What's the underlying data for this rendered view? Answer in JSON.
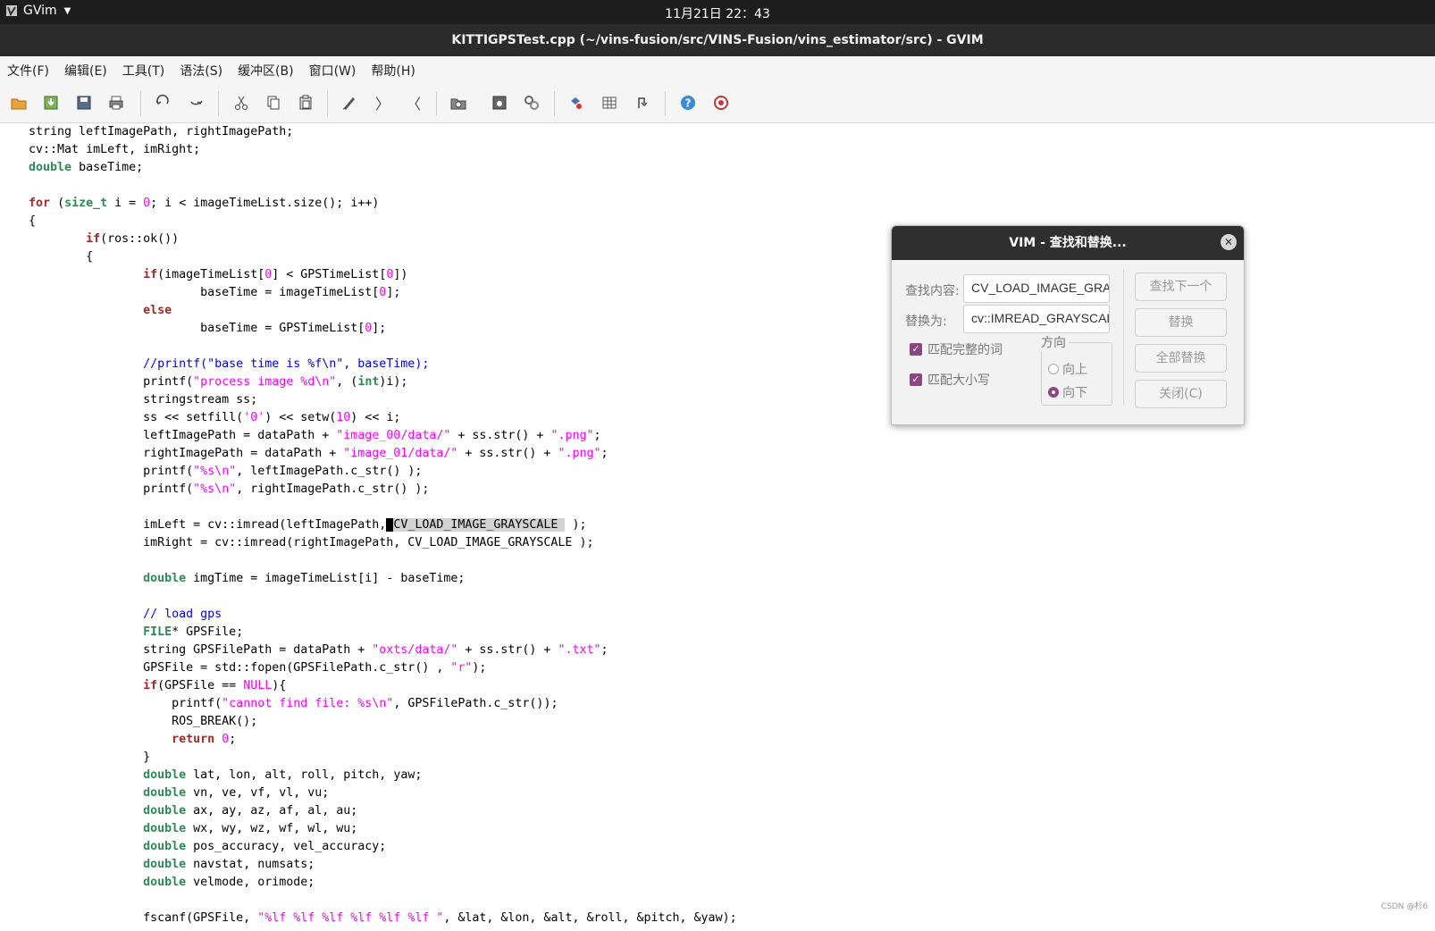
{
  "topbar": {
    "app_name": "GVim",
    "clock": "11月21日 22：43"
  },
  "window": {
    "title": "KITTIGPSTest.cpp (~/vins-fusion/src/VINS-Fusion/vins_estimator/src) - GVIM"
  },
  "menu": [
    "文件(F)",
    "编辑(E)",
    "工具(T)",
    "语法(S)",
    "缓冲区(B)",
    "窗口(W)",
    "帮助(H)"
  ],
  "toolbar_icons": [
    "open-icon",
    "save-download-icon",
    "save-icon",
    "print-icon",
    "undo-icon",
    "redo-icon",
    "cut-icon",
    "copy-icon",
    "paste-icon",
    "replace-icon",
    "forward-icon",
    "back-icon",
    "load-session-icon",
    "save-session-icon",
    "run-script-icon",
    "make-icon",
    "tags-icon",
    "jump-tag-icon",
    "help-icon",
    "find-help-icon"
  ],
  "code_lines": [
    [
      [
        "",
        "    string leftImagePath, rightImagePath;"
      ]
    ],
    [
      [
        "",
        "    cv::Mat imLeft, imRight;"
      ]
    ],
    [
      [
        "",
        "    "
      ],
      [
        "ty",
        "double"
      ],
      [
        "",
        " baseTime;"
      ]
    ],
    [
      [
        "",
        ""
      ]
    ],
    [
      [
        "",
        "    "
      ],
      [
        "kw",
        "for"
      ],
      [
        "",
        " ("
      ],
      [
        "ty",
        "size_t"
      ],
      [
        "",
        " i = "
      ],
      [
        "num",
        "0"
      ],
      [
        "",
        "; i < imageTimeList.size(); i++)"
      ]
    ],
    [
      [
        "",
        "    {"
      ]
    ],
    [
      [
        "",
        "            "
      ],
      [
        "kw",
        "if"
      ],
      [
        "",
        "(ros::ok())"
      ]
    ],
    [
      [
        "",
        "            {"
      ]
    ],
    [
      [
        "",
        "                    "
      ],
      [
        "kw",
        "if"
      ],
      [
        "",
        "(imageTimeList["
      ],
      [
        "num",
        "0"
      ],
      [
        "",
        "] < GPSTimeList["
      ],
      [
        "num",
        "0"
      ],
      [
        "",
        "])"
      ]
    ],
    [
      [
        "",
        "                            baseTime = imageTimeList["
      ],
      [
        "num",
        "0"
      ],
      [
        "",
        "];"
      ]
    ],
    [
      [
        "",
        "                    "
      ],
      [
        "kw",
        "else"
      ]
    ],
    [
      [
        "",
        "                            baseTime = GPSTimeList["
      ],
      [
        "num",
        "0"
      ],
      [
        "",
        "];"
      ]
    ],
    [
      [
        "",
        ""
      ]
    ],
    [
      [
        "",
        "                    "
      ],
      [
        "cm",
        "//printf(\"base time is %f\\n\", baseTime);"
      ]
    ],
    [
      [
        "",
        "                    printf("
      ],
      [
        "str",
        "\"process image "
      ],
      [
        "num",
        "%d\\n"
      ],
      [
        "str",
        "\""
      ],
      [
        "",
        ", ("
      ],
      [
        "ty",
        "int"
      ],
      [
        "",
        ")i);"
      ]
    ],
    [
      [
        "",
        "                    stringstream ss;"
      ]
    ],
    [
      [
        "",
        "                    ss << setfill("
      ],
      [
        "str",
        "'0'"
      ],
      [
        "",
        ") << setw("
      ],
      [
        "num",
        "10"
      ],
      [
        "",
        ") << i;"
      ]
    ],
    [
      [
        "",
        "                    leftImagePath = dataPath + "
      ],
      [
        "str",
        "\"image_00/data/\""
      ],
      [
        "",
        " + ss.str() + "
      ],
      [
        "str",
        "\".png\""
      ],
      [
        "",
        ";"
      ]
    ],
    [
      [
        "",
        "                    rightImagePath = dataPath + "
      ],
      [
        "str",
        "\"image_01/data/\""
      ],
      [
        "",
        " + ss.str() + "
      ],
      [
        "str",
        "\".png\""
      ],
      [
        "",
        ";"
      ]
    ],
    [
      [
        "",
        "                    printf("
      ],
      [
        "str",
        "\""
      ],
      [
        "num",
        "%s\\n"
      ],
      [
        "str",
        "\""
      ],
      [
        "",
        ", leftImagePath.c_str() );"
      ]
    ],
    [
      [
        "",
        "                    printf("
      ],
      [
        "str",
        "\""
      ],
      [
        "num",
        "%s\\n"
      ],
      [
        "str",
        "\""
      ],
      [
        "",
        ", rightImagePath.c_str() );"
      ]
    ],
    [
      [
        "",
        ""
      ]
    ],
    [
      [
        "",
        "                    imLeft = cv::imread(leftImagePath,"
      ],
      [
        "cursor",
        " "
      ],
      [
        "hl",
        "CV_LOAD_IMAGE_GRAYSCALE "
      ],
      [
        "",
        " );"
      ]
    ],
    [
      [
        "",
        "                    imRight = cv::imread(rightImagePath, CV_LOAD_IMAGE_GRAYSCALE );"
      ]
    ],
    [
      [
        "",
        ""
      ]
    ],
    [
      [
        "",
        "                    "
      ],
      [
        "ty",
        "double"
      ],
      [
        "",
        " imgTime = imageTimeList[i] - baseTime;"
      ]
    ],
    [
      [
        "",
        ""
      ]
    ],
    [
      [
        "",
        "                    "
      ],
      [
        "cm",
        "// load gps"
      ]
    ],
    [
      [
        "",
        "                    "
      ],
      [
        "ty",
        "FILE"
      ],
      [
        "",
        "* GPSFile;"
      ]
    ],
    [
      [
        "",
        "                    string GPSFilePath = dataPath + "
      ],
      [
        "str",
        "\"oxts/data/\""
      ],
      [
        "",
        " + ss.str() + "
      ],
      [
        "str",
        "\".txt\""
      ],
      [
        "",
        ";"
      ]
    ],
    [
      [
        "",
        "                    GPSFile = std::fopen(GPSFilePath.c_str() , "
      ],
      [
        "str",
        "\"r\""
      ],
      [
        "",
        ");"
      ]
    ],
    [
      [
        "",
        "                    "
      ],
      [
        "kw",
        "if"
      ],
      [
        "",
        "(GPSFile == "
      ],
      [
        "num",
        "NULL"
      ],
      [
        "",
        "){"
      ]
    ],
    [
      [
        "",
        "                        printf("
      ],
      [
        "str",
        "\"cannot find file: "
      ],
      [
        "num",
        "%s\\n"
      ],
      [
        "str",
        "\""
      ],
      [
        "",
        ", GPSFilePath.c_str());"
      ]
    ],
    [
      [
        "",
        "                        ROS_BREAK();"
      ]
    ],
    [
      [
        "",
        "                        "
      ],
      [
        "kw",
        "return"
      ],
      [
        "",
        " "
      ],
      [
        "num",
        "0"
      ],
      [
        "",
        ";"
      ]
    ],
    [
      [
        "",
        "                    }"
      ]
    ],
    [
      [
        "",
        "                    "
      ],
      [
        "ty",
        "double"
      ],
      [
        "",
        " lat, lon, alt, roll, pitch, yaw;"
      ]
    ],
    [
      [
        "",
        "                    "
      ],
      [
        "ty",
        "double"
      ],
      [
        "",
        " vn, ve, vf, vl, vu;"
      ]
    ],
    [
      [
        "",
        "                    "
      ],
      [
        "ty",
        "double"
      ],
      [
        "",
        " ax, ay, az, af, al, au;"
      ]
    ],
    [
      [
        "",
        "                    "
      ],
      [
        "ty",
        "double"
      ],
      [
        "",
        " wx, wy, wz, wf, wl, wu;"
      ]
    ],
    [
      [
        "",
        "                    "
      ],
      [
        "ty",
        "double"
      ],
      [
        "",
        " pos_accuracy, vel_accuracy;"
      ]
    ],
    [
      [
        "",
        "                    "
      ],
      [
        "ty",
        "double"
      ],
      [
        "",
        " navstat, numsats;"
      ]
    ],
    [
      [
        "",
        "                    "
      ],
      [
        "ty",
        "double"
      ],
      [
        "",
        " velmode, orimode;"
      ]
    ],
    [
      [
        "",
        ""
      ]
    ],
    [
      [
        "",
        "                    fscanf(GPSFile, "
      ],
      [
        "str",
        "\""
      ],
      [
        "num",
        "%lf %lf %lf %lf %lf %lf"
      ],
      [
        "str",
        " \""
      ],
      [
        "",
        ", &lat, &lon, &alt, &roll, &pitch, &yaw);"
      ]
    ]
  ],
  "dialog": {
    "title": "VIM - 查找和替换...",
    "find_label": "查找内容:",
    "find_value": "CV_LOAD_IMAGE_GRAYSCALE",
    "replace_label": "替换为:",
    "replace_value": "cv::IMREAD_GRAYSCALE",
    "whole_word_label": "匹配完整的词",
    "match_case_label": "匹配大小写",
    "direction_label": "方向",
    "up_label": "向上",
    "down_label": "向下",
    "find_next_button": "查找下一个",
    "replace_button": "替换",
    "replace_all_button": "全部替换",
    "close_button": "关闭(C)",
    "direction_selected": "向下",
    "whole_word_checked": true,
    "match_case_checked": true
  },
  "watermark": "CSDN @杉6",
  "colors": {
    "keyword": "#a52a2a",
    "type": "#2e8b57",
    "string": "#ff00ff",
    "comment": "#0000ff",
    "accent": "#8e4585"
  }
}
